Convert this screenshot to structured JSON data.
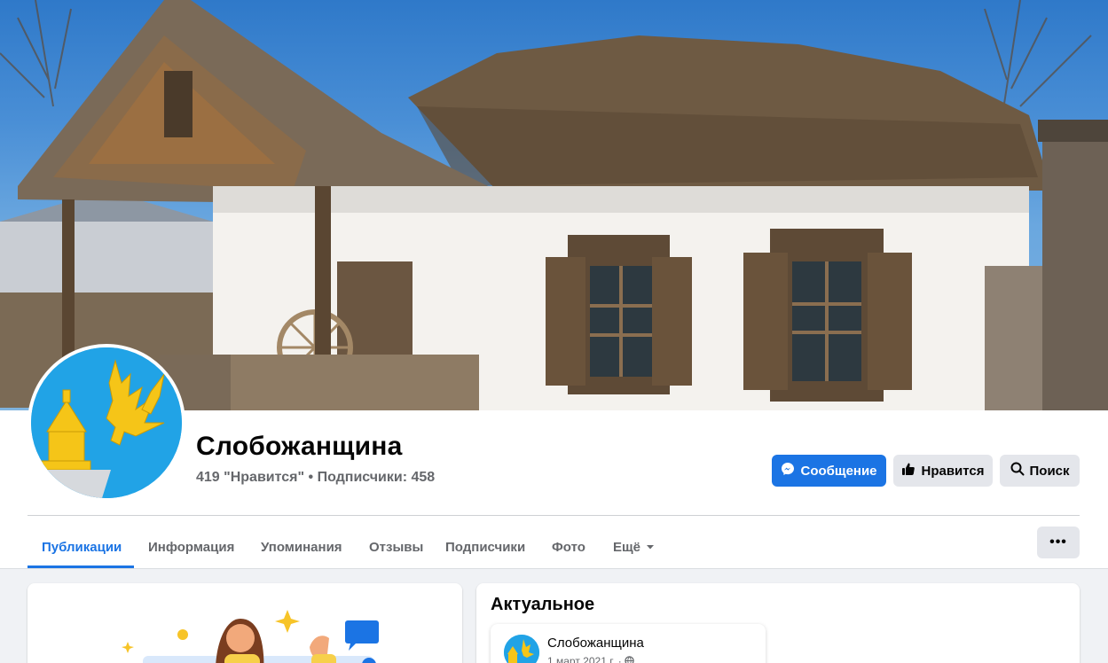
{
  "page": {
    "name": "Слобожанщина",
    "stats": "419 \"Нравится\" • Подписчики: 458"
  },
  "actions": {
    "message_label": "Сообщение",
    "like_label": "Нравится",
    "search_label": "Поиск"
  },
  "tabs": [
    {
      "label": "Публикации",
      "active": true
    },
    {
      "label": "Информация"
    },
    {
      "label": "Упоминания"
    },
    {
      "label": "Отзывы"
    },
    {
      "label": "Подписчики"
    },
    {
      "label": "Фото"
    },
    {
      "label": "Ещё"
    }
  ],
  "more_label": "•••",
  "featured": {
    "title": "Актуальное",
    "post": {
      "author": "Слобожанщина",
      "date": "1 март 2021 г. ·"
    }
  },
  "colors": {
    "accent": "#1b74e4",
    "page_bg": "#f0f2f5",
    "button_grey": "#e4e6eb",
    "avatar_blue": "#21a3e6",
    "emblem_gold": "#f5c518"
  },
  "icons": [
    "messenger-icon",
    "thumbs-up-icon",
    "search-icon",
    "caret-down-icon",
    "globe-icon"
  ]
}
